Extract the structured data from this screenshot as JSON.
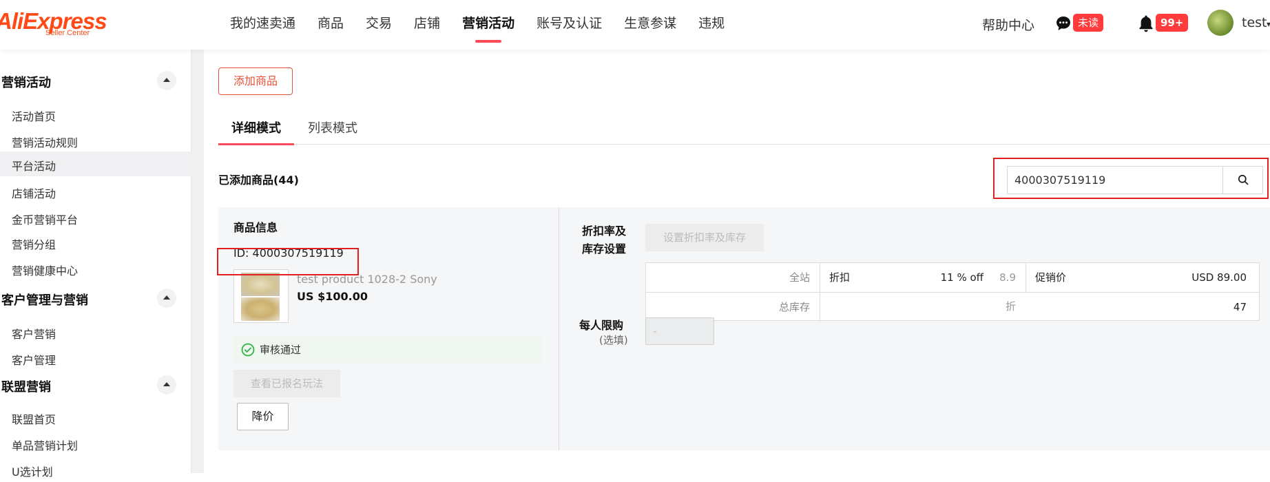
{
  "logo": {
    "main": "AliExpress",
    "sub": "Seller Center"
  },
  "topnav": [
    "我的速卖通",
    "商品",
    "交易",
    "店铺",
    "营销活动",
    "账号及认证",
    "生意参谋",
    "违规"
  ],
  "header": {
    "help": "帮助中心",
    "unread_badge": "未读",
    "notif_badge": "99+",
    "username": "test"
  },
  "sidebar": {
    "sections": [
      {
        "title": "营销活动",
        "items": [
          "活动首页",
          "营销活动规则",
          "平台活动",
          "店铺活动",
          "金币营销平台",
          "营销分组",
          "营销健康中心"
        ]
      },
      {
        "title": "客户管理与营销",
        "items": [
          "客户营销",
          "客户管理"
        ]
      },
      {
        "title": "联盟营销",
        "items": [
          "联盟首页",
          "单品营销计划",
          "U选计划"
        ]
      }
    ],
    "selected": "平台活动"
  },
  "main": {
    "add_button": "添加商品",
    "tabs": [
      "详细模式",
      "列表模式"
    ],
    "added_count": "已添加商品(44)",
    "search": {
      "value": "4000307519119"
    }
  },
  "product": {
    "info_title": "商品信息",
    "id_text": "ID: 4000307519119",
    "name": "test product 1028-2 Sony",
    "price": "US $100.00",
    "status": "审核通过",
    "view_button": "查看已报名玩法",
    "reduce_button": "降价"
  },
  "discount": {
    "label_line1": "折扣率及",
    "label_line2": "库存设置",
    "set_button": "设置折扣率及库存",
    "site_label": "全站",
    "discount_label": "折扣",
    "off_value": "11 % off",
    "zhe_value": "8.9 折",
    "promo_label": "促销价",
    "promo_value": "USD 89.00",
    "stock_label": "总库存",
    "stock_value": "47"
  },
  "limit": {
    "label": "每人限购",
    "optional": "(选填)",
    "value": "-"
  }
}
